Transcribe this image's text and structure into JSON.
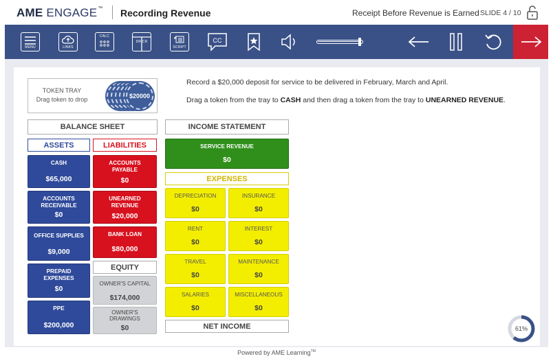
{
  "header": {
    "logo_bold": "AME",
    "logo_light": "ENGAGE",
    "logo_tm": "™",
    "title": "Recording Revenue",
    "subtitle": "Receipt Before Revenue is Earned",
    "slide": "SLIDE 4 / 10"
  },
  "toolbar": {
    "menu_label": "MENU",
    "links_label": "LINKS",
    "calc_label": "CALC",
    "drcr_label": "DR  CR",
    "script_label": "SCRIPT",
    "cc_label": "CC",
    "volume_level": 0.95
  },
  "tray": {
    "title": "TOKEN TRAY",
    "subtitle": "Drag token to drop",
    "token_value": "$20000"
  },
  "instructions": {
    "line1": "Record a $20,000 deposit for service to be delivered in February, March and April.",
    "line2_a": "Drag a token from the tray to ",
    "line2_b": "CASH",
    "line2_c": " and then drag a token from the tray to ",
    "line2_d": "UNEARNED REVENUE",
    "line2_e": "."
  },
  "balance_sheet": {
    "title": "BALANCE SHEET",
    "assets_label": "ASSETS",
    "liabilities_label": "LIABILITIES",
    "equity_label": "EQUITY",
    "assets": [
      {
        "name": "CASH",
        "value": "$65,000"
      },
      {
        "name": "ACCOUNTS RECEIVABLE",
        "value": "$0"
      },
      {
        "name": "OFFICE SUPPLIES",
        "value": "$9,000"
      },
      {
        "name": "PREPAID EXPENSES",
        "value": "$0"
      },
      {
        "name": "PPE",
        "value": "$200,000"
      }
    ],
    "liabilities": [
      {
        "name": "ACCOUNTS PAYABLE",
        "value": "$0"
      },
      {
        "name": "UNEARNED REVENUE",
        "value": "$20,000"
      },
      {
        "name": "BANK LOAN",
        "value": "$80,000"
      }
    ],
    "equity": [
      {
        "name": "OWNER'S CAPITAL",
        "value": "$174,000"
      },
      {
        "name": "OWNER'S DRAWINGS",
        "value": "$0"
      }
    ]
  },
  "income_statement": {
    "title": "INCOME STATEMENT",
    "revenue": {
      "name": "SERVICE REVENUE",
      "value": "$0"
    },
    "expenses_label": "EXPENSES",
    "expenses": [
      {
        "name": "DEPRECIATION",
        "value": "$0"
      },
      {
        "name": "INSURANCE",
        "value": "$0"
      },
      {
        "name": "RENT",
        "value": "$0"
      },
      {
        "name": "INTEREST",
        "value": "$0"
      },
      {
        "name": "TRAVEL",
        "value": "$0"
      },
      {
        "name": "MAINTENANCE",
        "value": "$0"
      },
      {
        "name": "SALARIES",
        "value": "$0"
      },
      {
        "name": "MISCELLANEOUS",
        "value": "$0"
      }
    ],
    "net_income_label": "NET INCOME"
  },
  "progress": {
    "label": "61%",
    "fraction": 0.61
  },
  "footer": {
    "text": "Powered by AME Learning",
    "tm": "TM"
  },
  "colors": {
    "toolbar": "#3a5187",
    "next": "#cc2233",
    "asset": "#2f4a9a",
    "liability": "#d8111e",
    "revenue": "#2f8f1a",
    "expense": "#f3ee00",
    "equity": "#d2d3d6"
  }
}
